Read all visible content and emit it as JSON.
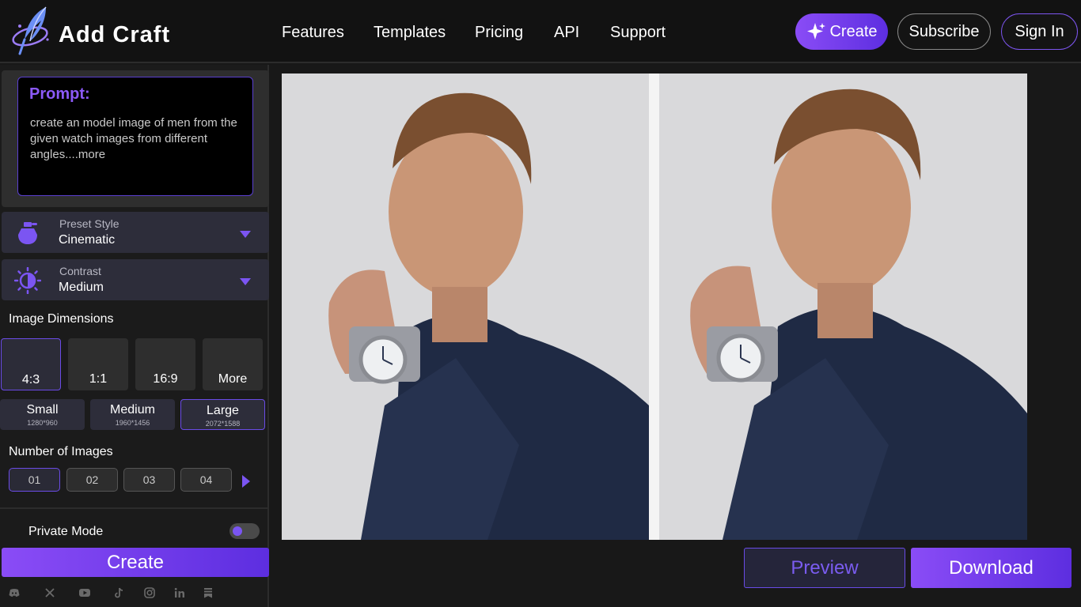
{
  "brand": {
    "name": "Add Craft",
    "logo_icon": "quill-feather-icon",
    "accent": "#7c4dff"
  },
  "nav": {
    "items": [
      "Features",
      "Templates",
      "Pricing",
      "API",
      "Support"
    ],
    "create": "Create",
    "subscribe": "Subscribe",
    "sign_in": "Sign In"
  },
  "prompt": {
    "title": "Prompt:",
    "text": "create an model image of men from the given watch images from different angles....more"
  },
  "preset_style": {
    "caption": "Preset Style",
    "value": "Cinematic",
    "icon": "perfume-bottle-icon"
  },
  "contrast": {
    "caption": "Contrast",
    "value": "Medium",
    "icon": "contrast-sun-icon"
  },
  "dimensions": {
    "label": "Image Dimensions",
    "ratios": [
      "4:3",
      "1:1",
      "16:9",
      "More"
    ],
    "selected_ratio": "4:3",
    "sizes": [
      {
        "label": "Small",
        "sub": "1280*960"
      },
      {
        "label": "Medium",
        "sub": "1960*1456"
      },
      {
        "label": "Large",
        "sub": "2072*1588"
      }
    ],
    "selected_size": "Large"
  },
  "number_of_images": {
    "label": "Number of Images",
    "options": [
      "01",
      "02",
      "03",
      "04"
    ],
    "selected": "01"
  },
  "private_mode": {
    "label": "Private Mode",
    "on": true
  },
  "create_button": "Create",
  "social": [
    "discord-icon",
    "x-icon",
    "youtube-icon",
    "tiktok-icon",
    "instagram-icon",
    "linkedin-icon",
    "substack-icon"
  ],
  "preview": {
    "images": [
      "man-in-navy-blazer-wearing-watch",
      "man-in-navy-blazer-wearing-watch-alt-angle"
    ],
    "preview_label": "Preview",
    "download_label": "Download"
  }
}
